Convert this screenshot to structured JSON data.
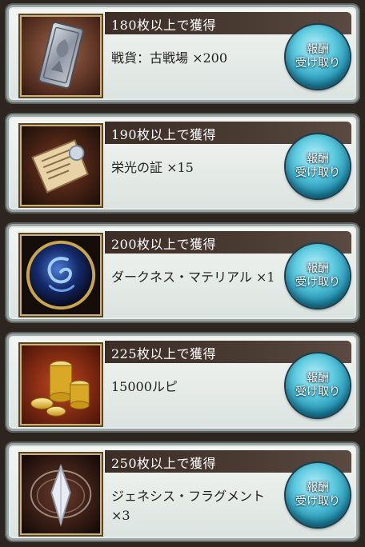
{
  "rewards": [
    {
      "threshold": "180枚以上で獲得",
      "item": "戦貨：古戦場 ×200",
      "button_line1": "報酬",
      "button_line2": "受け取り",
      "icon": "battle-medal-icon"
    },
    {
      "threshold": "190枚以上で獲得",
      "item": "栄光の証 ×15",
      "button_line1": "報酬",
      "button_line2": "受け取り",
      "icon": "parchment-scroll-icon"
    },
    {
      "threshold": "200枚以上で獲得",
      "item": "ダークネス・マテリアル ×1",
      "button_line1": "報酬",
      "button_line2": "受け取り",
      "icon": "dark-orb-icon"
    },
    {
      "threshold": "225枚以上で獲得",
      "item": "15000ルピ",
      "button_line1": "報酬",
      "button_line2": "受け取り",
      "icon": "gold-coins-icon"
    },
    {
      "threshold": "250枚以上で獲得",
      "item": "ジェネシス・フラグメント ×3",
      "button_line1": "報酬",
      "button_line2": "受け取り",
      "icon": "crystal-fragment-icon"
    }
  ],
  "colors": {
    "header_bg": "#3c2e27",
    "card_bg": "#e9eeec",
    "button": "#5fcbe0"
  }
}
